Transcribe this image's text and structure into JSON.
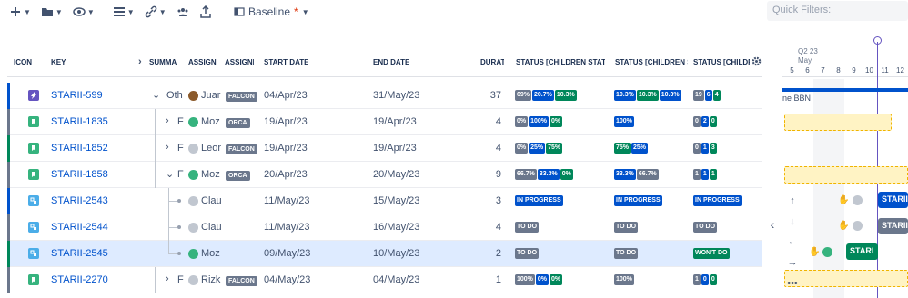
{
  "toolbar": {
    "baseline_label": "Baseline",
    "baseline_modified": "*",
    "quick_filters_placeholder": "Quick Filters:"
  },
  "columns": {
    "icon": "ICON",
    "key": "KEY",
    "summary": "SUMMA",
    "assignee": "ASSIGN",
    "assignee_team": "ASSIGNI",
    "start_date": "START DATE",
    "end_date": "END DATE",
    "duration": "DURAT",
    "status1": "STATUS [CHILDREN STATU",
    "status2": "STATUS [CHILDREN S",
    "status3": "STATUS [CHILDR"
  },
  "rows": [
    {
      "key": "STARII-599",
      "summary": "Oth",
      "assignee": "Juar",
      "team": "FALCON",
      "start": "04/Apr/23",
      "end": "31/May/23",
      "duration": "37",
      "s1": [
        [
          "69%",
          "g"
        ],
        [
          "20.7%",
          "b"
        ],
        [
          "10.3%",
          "n"
        ]
      ],
      "s2": [
        [
          "10.3%",
          "b"
        ],
        [
          "10.3%",
          "n"
        ],
        [
          "10.3%",
          "b"
        ]
      ],
      "s3": [
        [
          "19",
          "g"
        ],
        [
          "6",
          "b"
        ],
        [
          "4",
          "n"
        ]
      ]
    },
    {
      "key": "STARII-1835",
      "summary": "F",
      "assignee": "Moz",
      "team": "ORCA",
      "start": "19/Apr/23",
      "end": "19/Apr/23",
      "duration": "4",
      "s1": [
        [
          "0%",
          "g"
        ],
        [
          "100%",
          "b"
        ],
        [
          "0%",
          "n"
        ]
      ],
      "s2": [
        [
          "100%",
          "b"
        ]
      ],
      "s3": [
        [
          "0",
          "g"
        ],
        [
          "2",
          "b"
        ],
        [
          "0",
          "n"
        ]
      ]
    },
    {
      "key": "STARII-1852",
      "summary": "F",
      "assignee": "Leor",
      "team": "FALCON",
      "start": "19/Apr/23",
      "end": "19/Apr/23",
      "duration": "4",
      "s1": [
        [
          "0%",
          "g"
        ],
        [
          "25%",
          "b"
        ],
        [
          "75%",
          "n"
        ]
      ],
      "s2": [
        [
          "75%",
          "n"
        ],
        [
          "25%",
          "b"
        ]
      ],
      "s3": [
        [
          "0",
          "g"
        ],
        [
          "1",
          "b"
        ],
        [
          "3",
          "n"
        ]
      ]
    },
    {
      "key": "STARII-1858",
      "summary": "F",
      "assignee": "Moz",
      "team": "ORCA",
      "start": "20/Apr/23",
      "end": "20/May/23",
      "duration": "9",
      "s1": [
        [
          "66.7%",
          "g"
        ],
        [
          "33.3%",
          "b"
        ],
        [
          "0%",
          "n"
        ]
      ],
      "s2": [
        [
          "33.3%",
          "b"
        ],
        [
          "66.7%",
          "g"
        ]
      ],
      "s3": [
        [
          "1",
          "g"
        ],
        [
          "1",
          "b"
        ],
        [
          "1",
          "n"
        ]
      ]
    },
    {
      "key": "STARII-2543",
      "summary": "",
      "assignee": "Clau",
      "team": "",
      "start": "11/May/23",
      "end": "15/May/23",
      "duration": "3",
      "s1": [
        [
          "IN PROGRESS",
          "b"
        ]
      ],
      "s2": [
        [
          "IN PROGRESS",
          "b"
        ]
      ],
      "s3": [
        [
          "IN PROGRESS",
          "b"
        ]
      ]
    },
    {
      "key": "STARII-2544",
      "summary": "",
      "assignee": "Clau",
      "team": "",
      "start": "11/May/23",
      "end": "16/May/23",
      "duration": "4",
      "s1": [
        [
          "TO DO",
          "g"
        ]
      ],
      "s2": [
        [
          "TO DO",
          "g"
        ]
      ],
      "s3": [
        [
          "TO DO",
          "g"
        ]
      ]
    },
    {
      "key": "STARII-2545",
      "summary": "",
      "assignee": "Moz",
      "team": "",
      "start": "09/May/23",
      "end": "10/May/23",
      "duration": "2",
      "s1": [
        [
          "TO DO",
          "g"
        ]
      ],
      "s2": [
        [
          "TO DO",
          "g"
        ]
      ],
      "s3": [
        [
          "WON'T DO",
          "n"
        ]
      ]
    },
    {
      "key": "STARII-2270",
      "summary": "F",
      "assignee": "Rizk",
      "team": "FALCON",
      "start": "04/May/23",
      "end": "04/May/23",
      "duration": "1",
      "s1": [
        [
          "100%",
          "g"
        ],
        [
          "0%",
          "b"
        ],
        [
          "0%",
          "n"
        ]
      ],
      "s2": [
        [
          "100%",
          "g"
        ]
      ],
      "s3": [
        [
          "1",
          "g"
        ],
        [
          "0",
          "b"
        ],
        [
          "0",
          "n"
        ]
      ]
    }
  ],
  "gantt": {
    "quarter": "Q2 23",
    "month": "May",
    "days": [
      "5",
      "6",
      "7",
      "8",
      "9",
      "10",
      "11",
      "12"
    ],
    "summary_bar_label": "ne BBN",
    "bars": [
      "STARII-",
      "STARII-",
      "STARI"
    ]
  },
  "colors": {
    "accent": "#0052cc",
    "today": "#6554c0",
    "epic": "#6554c0",
    "story": "#36b37e",
    "subtask": "#4bade8",
    "progress": "#0052cc",
    "done": "#00875a",
    "todo": "#6b778c"
  }
}
